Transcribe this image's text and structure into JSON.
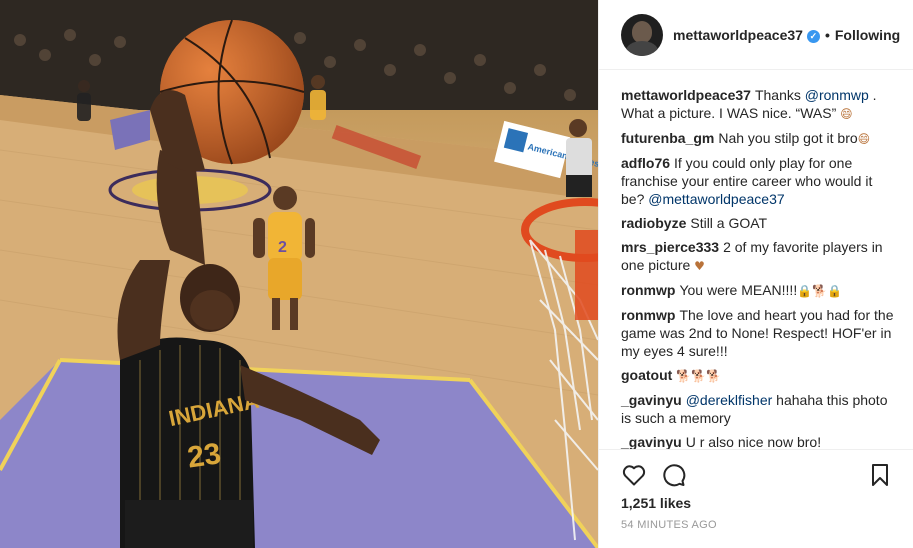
{
  "post": {
    "image_alt": "",
    "jersey_text": "INDIANA",
    "jersey_number": "23",
    "opponent_number": "2",
    "ad_text": "American Express"
  },
  "header": {
    "username": "mettaworldpeace37",
    "separator": "•",
    "follow_label": "Following"
  },
  "comments": [
    {
      "user": "mettaworldpeace37",
      "before": "Thanks ",
      "mention": "@ronmwp",
      "after": " . What a picture. I WAS nice. “WAS” ",
      "emoji": "😄"
    },
    {
      "user": "futurenba_gm",
      "before": "Nah you stilp got it bro",
      "mention": "",
      "after": "",
      "emoji": "😄"
    },
    {
      "user": "adflo76",
      "before": "If you could only play for one franchise your entire career who would it be? ",
      "mention": "@mettaworldpeace37",
      "after": "",
      "emoji": ""
    },
    {
      "user": "radiobyze",
      "before": "Still a GOAT",
      "mention": "",
      "after": "",
      "emoji": ""
    },
    {
      "user": "mrs_pierce333",
      "before": "2 of my favorite players in one picture ",
      "mention": "",
      "after": "",
      "emoji": "♥"
    },
    {
      "user": "ronmwp",
      "before": "You were MEAN!!!!",
      "mention": "",
      "after": "",
      "emoji": "🔒🐕🔒"
    },
    {
      "user": "ronmwp",
      "before": "The love and heart you had for the game was 2nd to None! Respect! HOF'er in my eyes 4 sure!!!",
      "mention": "",
      "after": "",
      "emoji": ""
    },
    {
      "user": "goatout",
      "before": "",
      "mention": "",
      "after": "",
      "emoji": "🐕🐕🐕"
    },
    {
      "user": "_gavinyu",
      "before": "",
      "mention": "@dereklfisher",
      "after": " hahaha this photo is such a memory",
      "emoji": ""
    },
    {
      "user": "_gavinyu",
      "before": "U r also nice now bro!",
      "mention": "",
      "after": "",
      "emoji": ""
    }
  ],
  "footer": {
    "likes": "1,251 likes",
    "time": "54 MINUTES AGO"
  },
  "icons": {
    "like": "heart-outline-icon",
    "comment": "speech-bubble-icon",
    "save": "bookmark-icon",
    "verified": "verified-badge-icon"
  },
  "colors": {
    "link": "#003569",
    "verified": "#3897f0",
    "muted": "#999999",
    "text": "#262626"
  }
}
